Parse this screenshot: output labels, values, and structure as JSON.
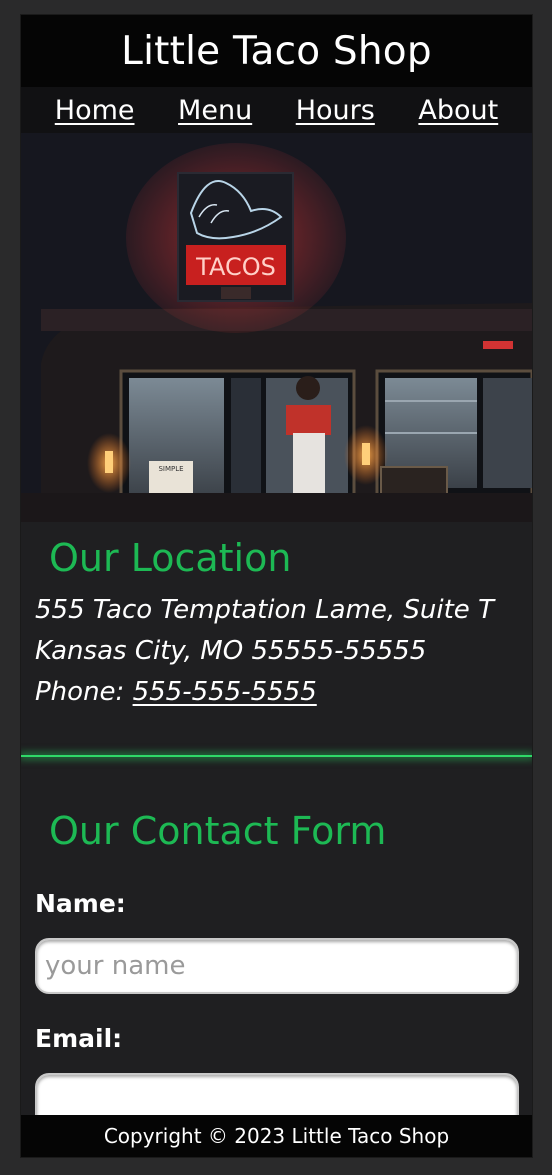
{
  "header": {
    "title": "Little Taco Shop"
  },
  "nav": {
    "items": [
      {
        "label": "Home"
      },
      {
        "label": "Menu"
      },
      {
        "label": "Hours"
      },
      {
        "label": "About"
      }
    ]
  },
  "hero": {
    "sign_text": "TACOS",
    "menu_card_text": "SIMPLE"
  },
  "location": {
    "heading": "Our Location",
    "address_line1": "555 Taco Temptation Lame, Suite T",
    "address_line2": "Kansas City, MO 55555-55555",
    "phone_label": "Phone: ",
    "phone": "555-555-5555"
  },
  "contact": {
    "heading": "Our Contact Form",
    "name_label": "Name:",
    "name_placeholder": "your name",
    "email_label": "Email:"
  },
  "footer": {
    "text": "Copyright © 2023 Little Taco Shop"
  },
  "colors": {
    "accent": "#1db954",
    "divider": "#2fd968",
    "header_bg": "#050505"
  }
}
